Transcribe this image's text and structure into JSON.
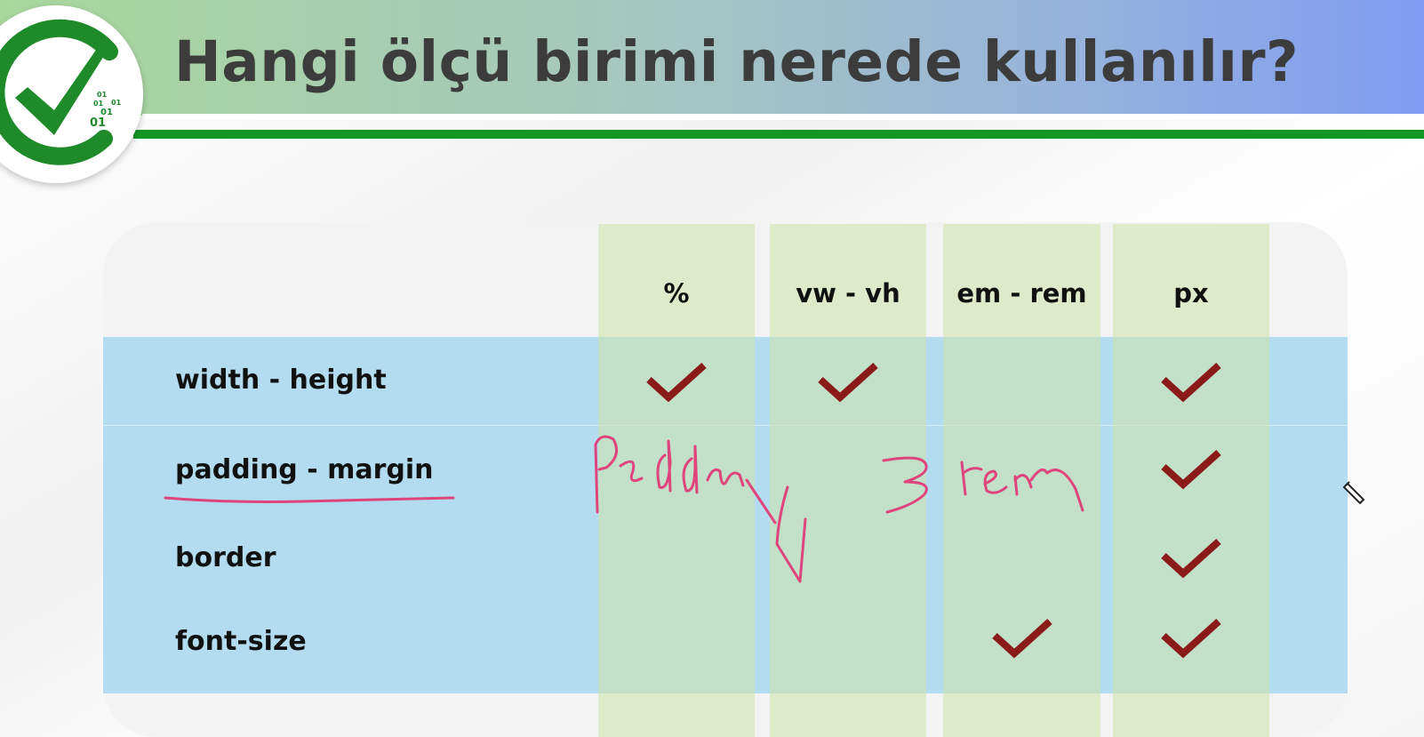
{
  "slide": {
    "title": "Hangi ölçü birimi nerede kullanılır?",
    "logo_text": [
      "01",
      "01",
      "01",
      "01",
      "01"
    ]
  },
  "table": {
    "columns": [
      "%",
      "vw - vh",
      "em - rem",
      "px"
    ],
    "rows": [
      {
        "label": "width - height",
        "checks": [
          true,
          true,
          false,
          true
        ]
      },
      {
        "label": "padding - margin",
        "checks": [
          false,
          false,
          false,
          true
        ]
      },
      {
        "label": "border",
        "checks": [
          false,
          false,
          false,
          true
        ]
      },
      {
        "label": "font-size",
        "checks": [
          false,
          false,
          true,
          true
        ]
      }
    ]
  },
  "annotations": {
    "handwriting": [
      "Padding",
      "3rem"
    ],
    "ink_color": "#e0447c",
    "underlined_row": "padding - margin"
  },
  "colors": {
    "check": "#8b1a1a",
    "logo_green": "#1e8a2a",
    "rule_green": "#149624",
    "title": "#3c3c3c"
  }
}
